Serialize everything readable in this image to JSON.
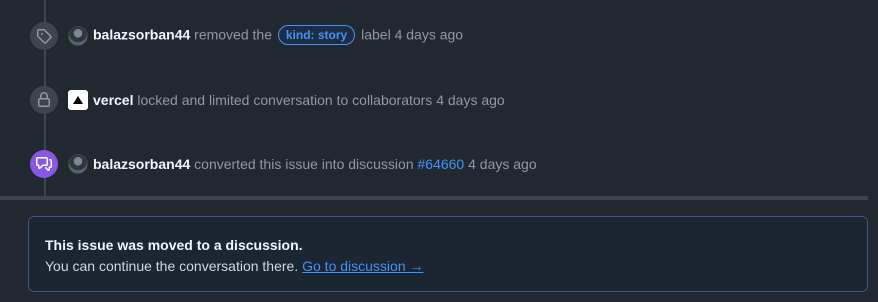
{
  "timeline": {
    "events": [
      {
        "icon": "tag-icon",
        "author": "balazsorban44",
        "action_before": "removed the",
        "label": "kind: story",
        "action_after": "label 4 days ago"
      },
      {
        "icon": "lock-icon",
        "author": "vercel",
        "action": "locked and limited conversation to collaborators 4 days ago"
      },
      {
        "icon": "discussion-icon",
        "author": "balazsorban44",
        "action_before": "converted this issue into discussion",
        "discussion_number": "#64660",
        "action_after": "4 days ago"
      }
    ]
  },
  "notice": {
    "title": "This issue was moved to a discussion.",
    "body": "You can continue the conversation there.",
    "link_text": "Go to discussion →"
  },
  "colors": {
    "background": "#212830",
    "accent_blue": "#4493f8",
    "discussion_purple": "#8957e5"
  }
}
